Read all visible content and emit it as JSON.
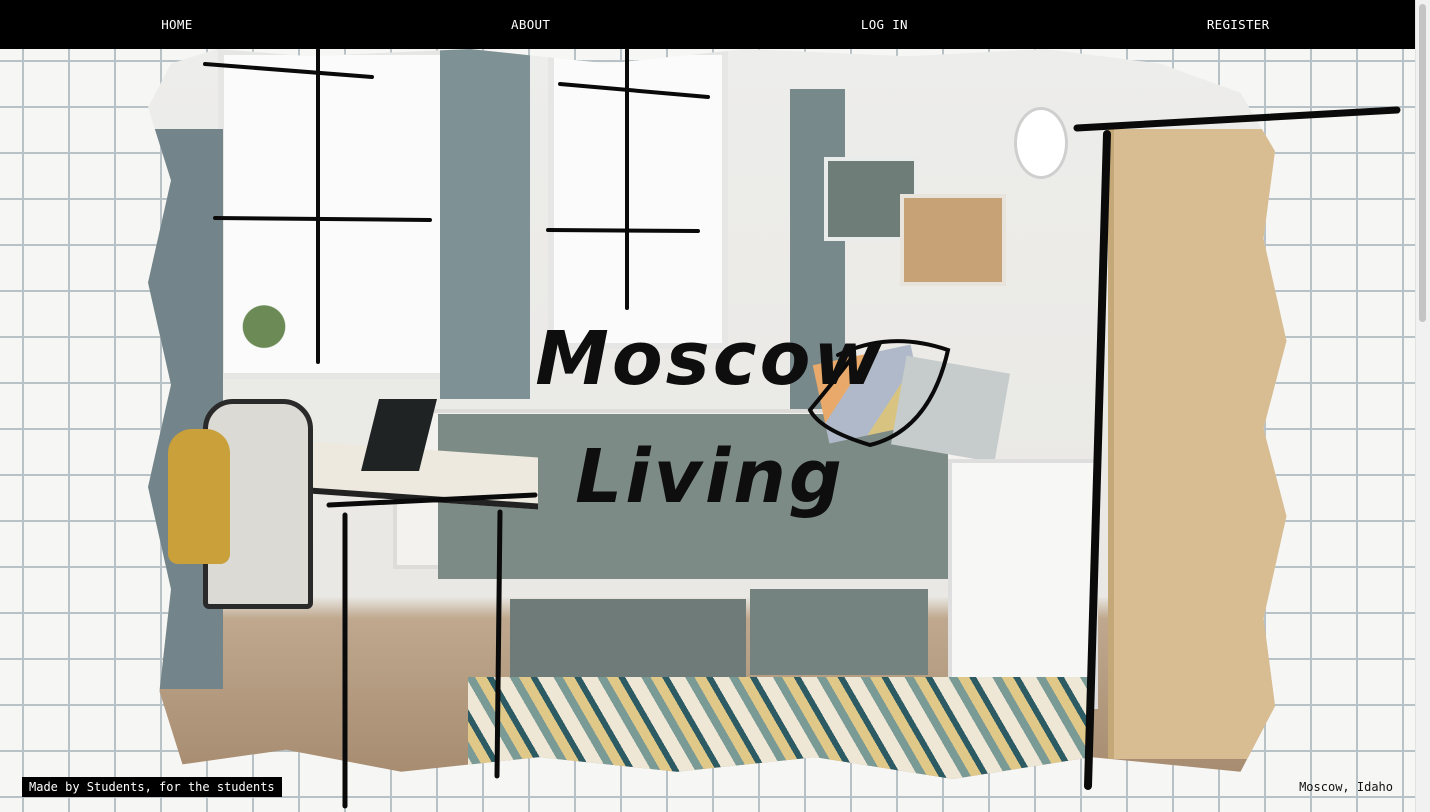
{
  "nav": {
    "items": [
      "HOME",
      "ABOUT",
      "LOG IN",
      "REGISTER"
    ]
  },
  "hero": {
    "title_line1": "Moscow",
    "title_line2": "Living"
  },
  "footer": {
    "tagline": "Made by Students, for the students",
    "location": "Moscow, Idaho"
  },
  "colors": {
    "navbar_bg": "#000000",
    "nav_text": "#ffffff",
    "grid_line": "#b8c2c6",
    "page_bg": "#f6f6f4"
  },
  "icons": {
    "scene": "bedroom-photo",
    "decor": "sketch-lines"
  }
}
